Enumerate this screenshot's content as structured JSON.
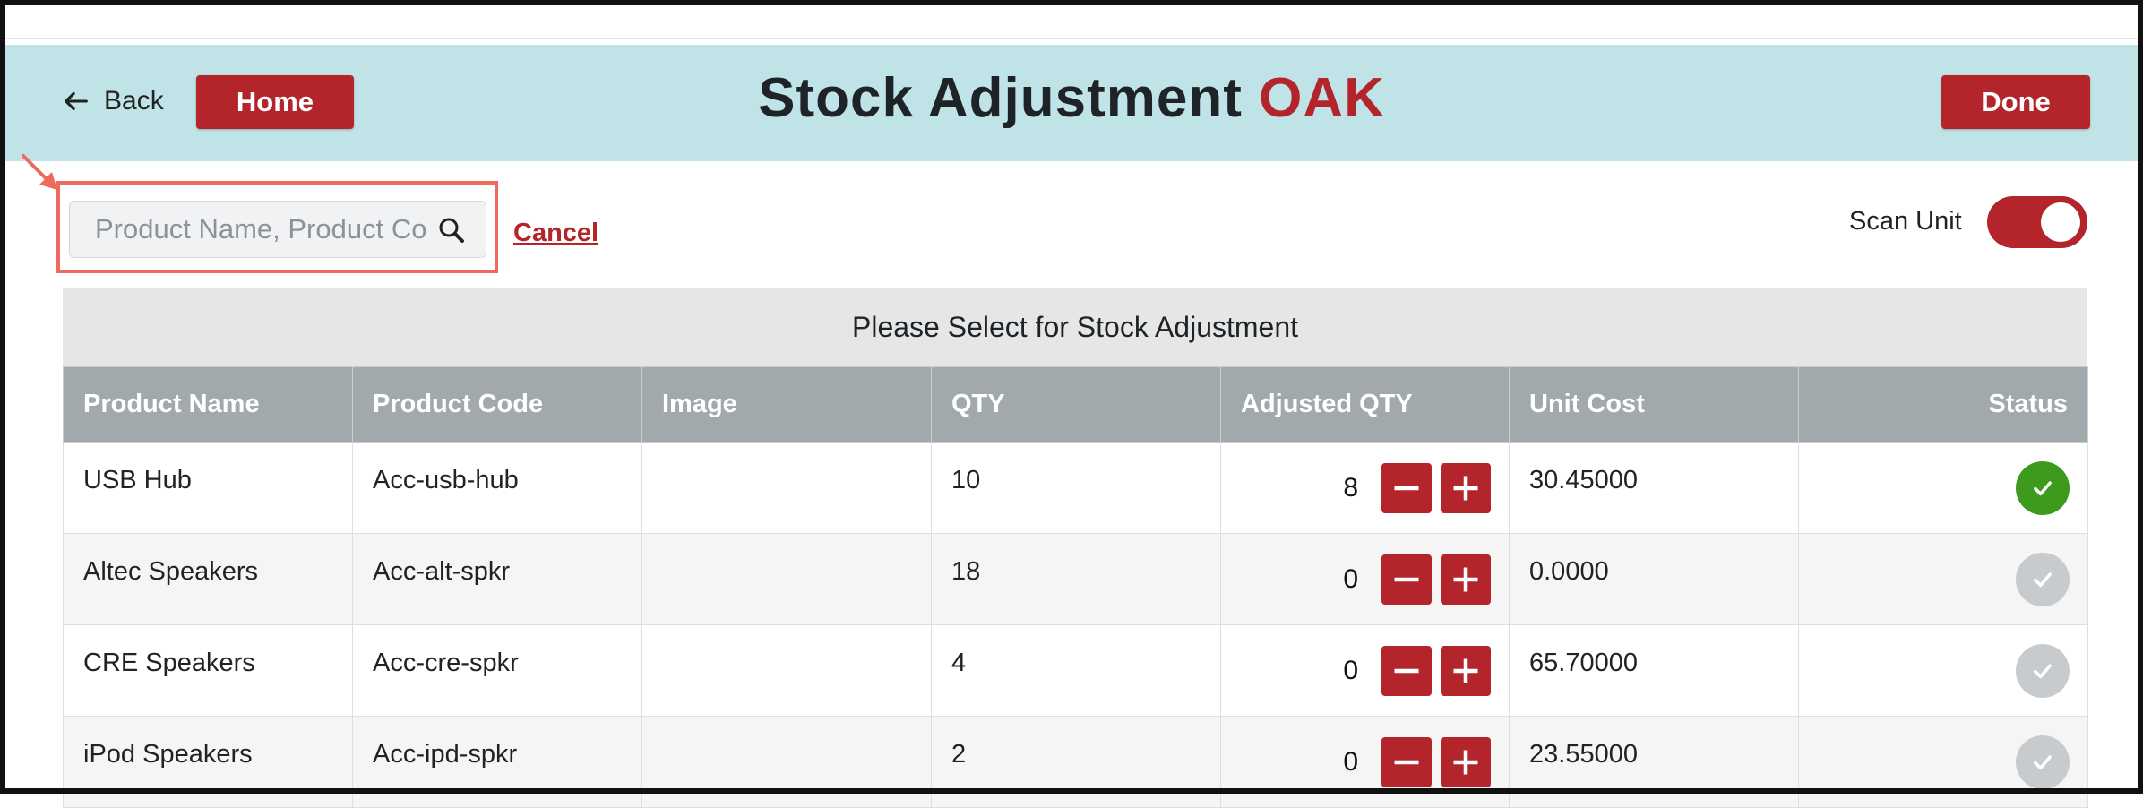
{
  "header": {
    "back_label": "Back",
    "home_label": "Home",
    "title_main": "Stock Adjustment",
    "title_accent": "OAK",
    "done_label": "Done"
  },
  "search": {
    "placeholder": "Product Name, Product Code",
    "value": "",
    "cancel_label": "Cancel"
  },
  "scan_unit": {
    "label": "Scan Unit",
    "enabled": true
  },
  "table": {
    "title": "Please Select for Stock Adjustment",
    "columns": {
      "product_name": "Product Name",
      "product_code": "Product Code",
      "image": "Image",
      "qty": "QTY",
      "adjusted_qty": "Adjusted QTY",
      "unit_cost": "Unit Cost",
      "status": "Status"
    },
    "rows": [
      {
        "product_name": "USB Hub",
        "product_code": "Acc-usb-hub",
        "qty": "10",
        "adjusted_qty": "8",
        "unit_cost": "30.45000",
        "status": "selected"
      },
      {
        "product_name": "Altec Speakers",
        "product_code": "Acc-alt-spkr",
        "qty": "18",
        "adjusted_qty": "0",
        "unit_cost": "0.0000",
        "status": "unselected"
      },
      {
        "product_name": "CRE Speakers",
        "product_code": "Acc-cre-spkr",
        "qty": "4",
        "adjusted_qty": "0",
        "unit_cost": "65.70000",
        "status": "unselected"
      },
      {
        "product_name": "iPod Speakers",
        "product_code": "Acc-ipd-spkr",
        "qty": "2",
        "adjusted_qty": "0",
        "unit_cost": "23.55000",
        "status": "unselected"
      }
    ]
  },
  "colors": {
    "header_bg": "#bfe3e6",
    "accent_red": "#b3252a",
    "status_selected": "#3d9a1c",
    "status_unselected": "#c7cbcd",
    "highlight_box": "#ee6a5e"
  },
  "icons": [
    "arrow-left-icon",
    "search-icon",
    "minus-icon",
    "plus-icon",
    "check-icon",
    "pointer-arrow-icon"
  ]
}
